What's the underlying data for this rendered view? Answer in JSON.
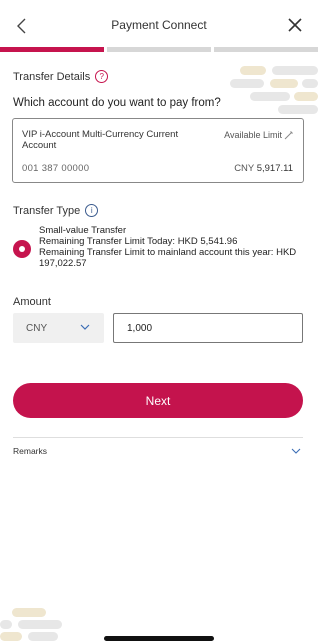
{
  "header": {
    "title": "Payment Connect"
  },
  "progress": {
    "steps": 3,
    "current_step": 1
  },
  "transfer_details": {
    "title": "Transfer Details",
    "question": "Which account do you want to pay from?",
    "account": {
      "name": "VIP i-Account Multi-Currency Current Account",
      "number": "001 387 00000",
      "limit_label": "Available Limit",
      "currency": "CNY",
      "balance": "5,917.11"
    }
  },
  "transfer_type": {
    "title": "Transfer Type",
    "option_name": "Small-value Transfer",
    "limit_today": "Remaining Transfer Limit Today: HKD 5,541.96",
    "limit_mainland": "Remaining Transfer Limit to mainland account this year: HKD 197,022.57"
  },
  "amount": {
    "label": "Amount",
    "currency": "CNY",
    "value": "1,000"
  },
  "next_button": {
    "label": "Next"
  },
  "remarks": {
    "label": "Remarks"
  },
  "colors": {
    "brand": "#c6144e",
    "progress_inactive": "#d7d7d7",
    "deco_gray": "#e7e7e7",
    "deco_beige": "#efe6cf"
  },
  "icons": [
    "back-arrow-icon",
    "close-icon",
    "help-icon",
    "info-icon",
    "pencil-icon",
    "chevron-down-icon"
  ]
}
